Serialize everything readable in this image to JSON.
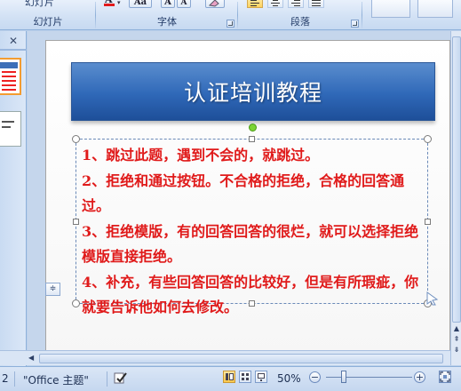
{
  "ribbon": {
    "slides_group_cut": "幻灯片",
    "slides_group_label": "幻灯片",
    "font_group_label": "字体",
    "font_button_aa": "Aa",
    "font_button_grow": "A",
    "font_button_shrink": "A",
    "paragraph_group_label": "段落"
  },
  "left_pane": {
    "close_glyph": "✕"
  },
  "slide": {
    "title": "认证培训教程",
    "bullets": [
      "1、跳过此题，遇到不会的，就跳过。",
      "2、拒绝和通过按钮。不合格的拒绝，合格的回答通过。",
      "3、拒绝模版，有的回答回答的很烂，就可以选择拒绝模版直接拒绝。",
      "4、补充，有些回答回答的比较好，但是有所瑕疵，你就要告诉他如何去修改。"
    ],
    "autofit_glyph": "≑"
  },
  "statusbar": {
    "slide_number_fragment": "2",
    "theme": "\"Office 主题\"",
    "zoom_percent": "50%",
    "zoom_out": "−",
    "zoom_in": "+"
  },
  "colors": {
    "title_bar": "#2f68b8",
    "body_text": "#e01a1a",
    "rotate_handle": "#7bd434",
    "active_thumbnail_border": "#f39c31"
  },
  "icons": [
    "font-color-icon",
    "change-case-icon",
    "grow-font-icon",
    "shrink-font-icon",
    "clear-format-icon",
    "align-left-icon",
    "align-center-icon",
    "align-right-icon",
    "justify-icon",
    "close-icon",
    "autofit-options-icon",
    "spelling-check-icon",
    "normal-view-icon",
    "slide-sorter-icon",
    "slideshow-icon",
    "fit-window-icon"
  ]
}
